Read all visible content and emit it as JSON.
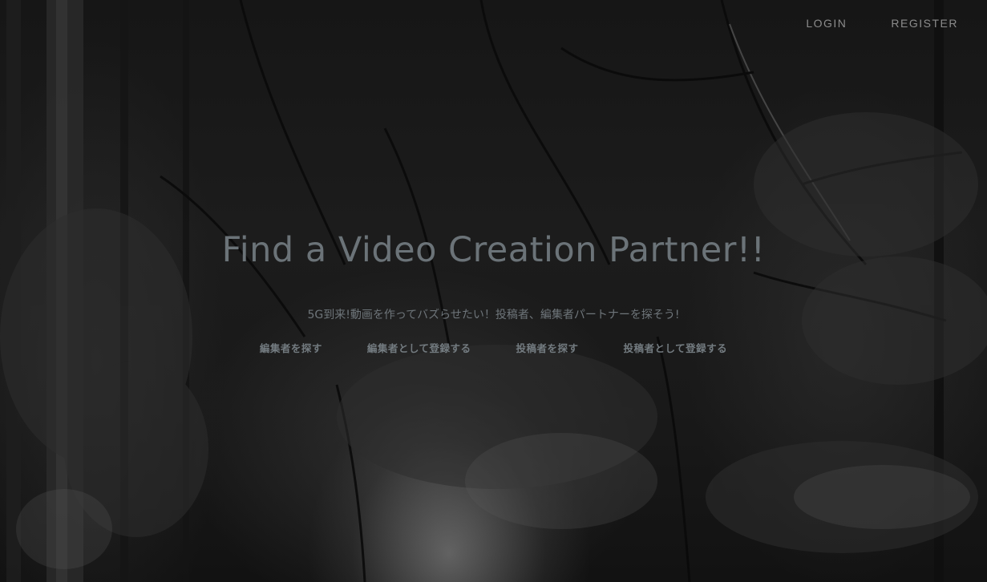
{
  "nav": {
    "login_label": "LOGIN",
    "register_label": "REGISTER"
  },
  "hero": {
    "title": "Find a Video Creation Partner!!",
    "subtitle": "5G到来!動画を作ってバズらせたい！投稿者、編集者パートナーを探そう!",
    "links": [
      {
        "label": "編集者を探す"
      },
      {
        "label": "編集者として登録する"
      },
      {
        "label": "投稿者を探す"
      },
      {
        "label": "投稿者として登録する"
      }
    ]
  },
  "colors": {
    "nav_text": "#8c8c8c",
    "title_text": "#6b7378",
    "background": "#161616"
  }
}
